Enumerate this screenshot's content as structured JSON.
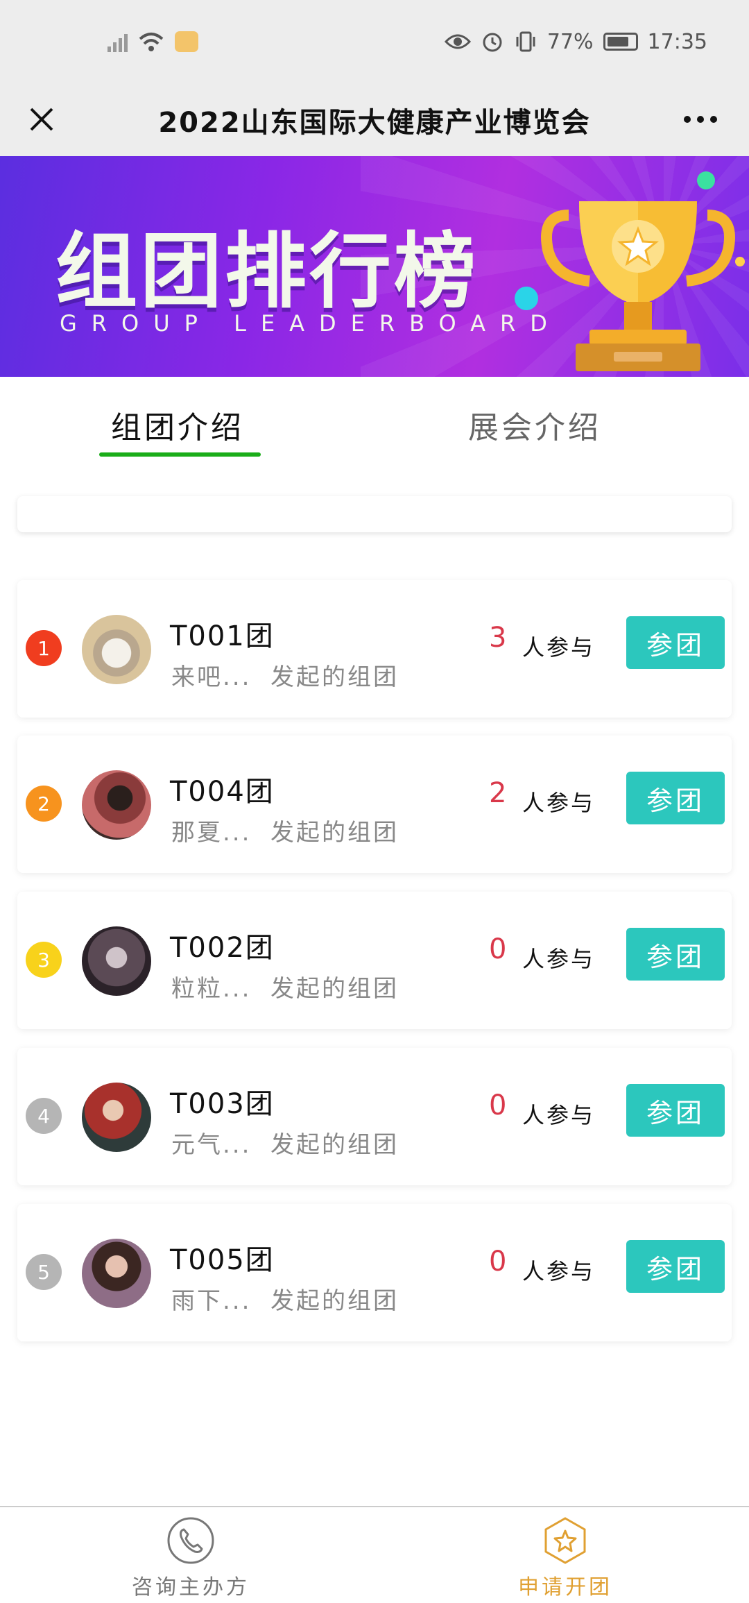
{
  "status_bar": {
    "battery": "77%",
    "time": "17:35"
  },
  "header": {
    "title": "2022山东国际大健康产业博览会"
  },
  "banner": {
    "title": "组团排行榜",
    "subtitle": "GROUP LEADERBOARD"
  },
  "tabs": [
    {
      "label": "组团介绍",
      "active": true
    },
    {
      "label": "展会介绍",
      "active": false
    }
  ],
  "groups": [
    {
      "rank": "1",
      "rank_color": "#f03d1f",
      "name": "T001团",
      "subtitle": "来吧...  发起的组团",
      "count": "3",
      "count_label": "人参与",
      "join_label": "参团"
    },
    {
      "rank": "2",
      "rank_color": "#f7931e",
      "name": "T004团",
      "subtitle": "那夏...  发起的组团",
      "count": "2",
      "count_label": "人参与",
      "join_label": "参团"
    },
    {
      "rank": "3",
      "rank_color": "#f8d21b",
      "name": "T002团",
      "subtitle": "粒粒...  发起的组团",
      "count": "0",
      "count_label": "人参与",
      "join_label": "参团"
    },
    {
      "rank": "4",
      "rank_color": "#b5b5b5",
      "name": "T003团",
      "subtitle": "元气...  发起的组团",
      "count": "0",
      "count_label": "人参与",
      "join_label": "参团"
    },
    {
      "rank": "5",
      "rank_color": "#b5b5b5",
      "name": "T005团",
      "subtitle": "雨下...  发起的组团",
      "count": "0",
      "count_label": "人参与",
      "join_label": "参团"
    }
  ],
  "bottom_nav": {
    "contact_label": "咨询主办方",
    "apply_label": "申请开团"
  },
  "colors": {
    "accent": "#2cc7bd",
    "tab_underline": "#1aad19",
    "count": "#d9384a",
    "apply": "#e0a032"
  }
}
